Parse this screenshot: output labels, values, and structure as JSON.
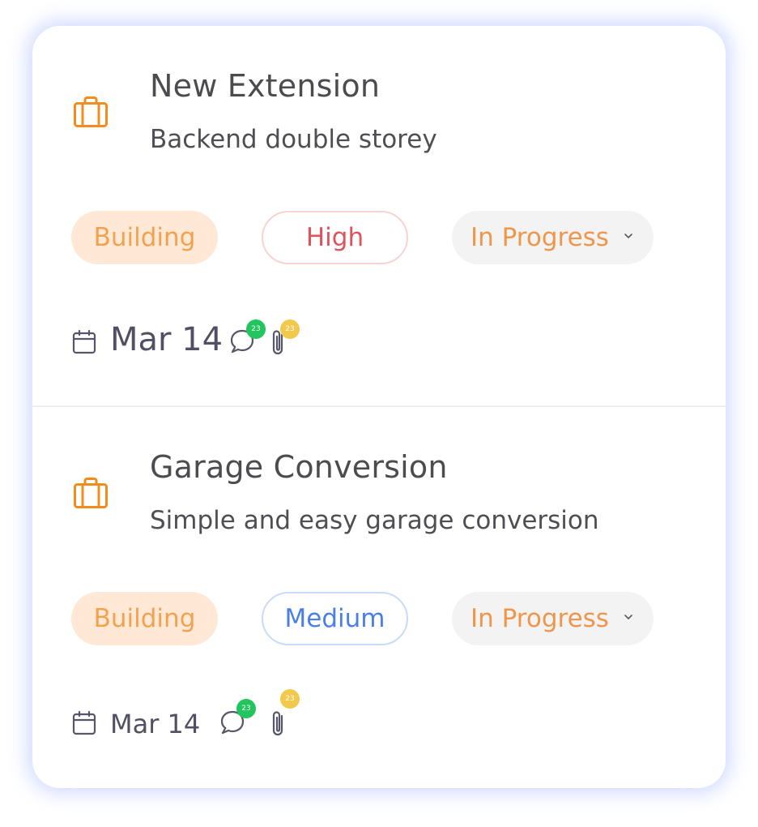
{
  "colors": {
    "accent_orange": "#f28c1e",
    "high_priority": "#e0525a",
    "medium_priority": "#4a7fe6",
    "comment_badge": "#22c55e",
    "attachment_badge": "#f2c94c"
  },
  "tasks": [
    {
      "icon": "briefcase-icon",
      "title": "New Extension",
      "subtitle": "Backend double storey",
      "category": "Building",
      "priority": "High",
      "status": "In Progress",
      "date": "Mar 14",
      "comments_count": "23",
      "attachments_count": "23"
    },
    {
      "icon": "briefcase-icon",
      "title": "Garage Conversion",
      "subtitle": "Simple and easy garage conversion",
      "category": "Building",
      "priority": "Medium",
      "status": "In Progress",
      "date": "Mar 14",
      "comments_count": "23",
      "attachments_count": "23"
    }
  ]
}
